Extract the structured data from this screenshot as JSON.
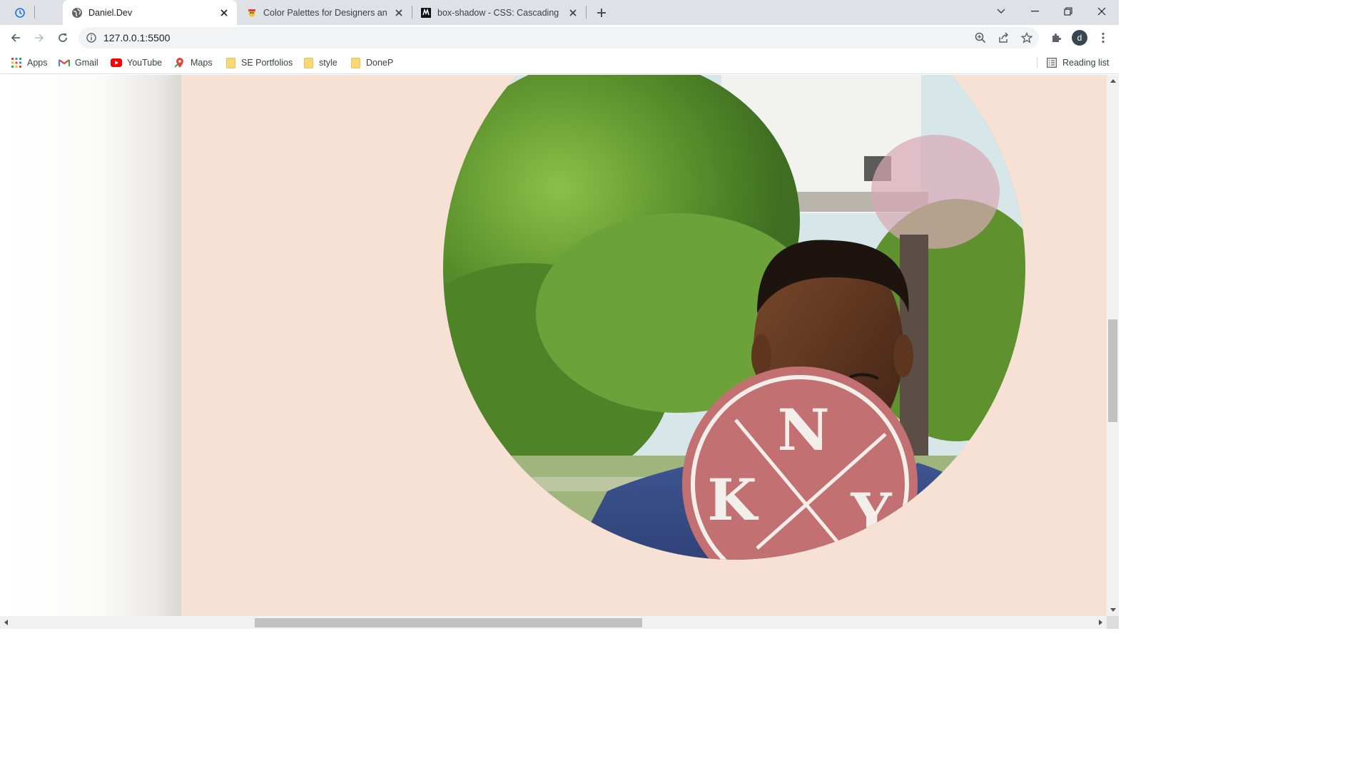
{
  "browser": {
    "tabs": [
      {
        "title": "Daniel.Dev",
        "active": true,
        "favicon": "globe-icon"
      },
      {
        "title": "Color Palettes for Designers and",
        "active": false,
        "favicon": "coolors-icon"
      },
      {
        "title": "box-shadow - CSS: Cascading Sty",
        "active": false,
        "favicon": "mdn-icon"
      }
    ],
    "url": "127.0.0.1:5500",
    "profile_initial": "d",
    "bookmarks": [
      {
        "label": "Apps",
        "icon": "apps-grid-icon"
      },
      {
        "label": "Gmail",
        "icon": "gmail-icon"
      },
      {
        "label": "YouTube",
        "icon": "youtube-icon"
      },
      {
        "label": "Maps",
        "icon": "maps-icon"
      },
      {
        "label": "SE Portfolios",
        "icon": "folder-icon"
      },
      {
        "label": "style",
        "icon": "folder-icon"
      },
      {
        "label": "DoneP",
        "icon": "folder-icon"
      }
    ],
    "reading_list_label": "Reading list"
  },
  "page": {
    "background_color": "#f7e1d4",
    "profile_photo": "portrait of a man in a blue NY t-shirt in front of trees, cropped in a circle"
  },
  "photo_shirt_text": {
    "l1": "N",
    "l2": "K",
    "l3": "Y"
  },
  "colors": {
    "accent_page": "#f7e1d4",
    "tabstrip": "#dee1e6"
  }
}
